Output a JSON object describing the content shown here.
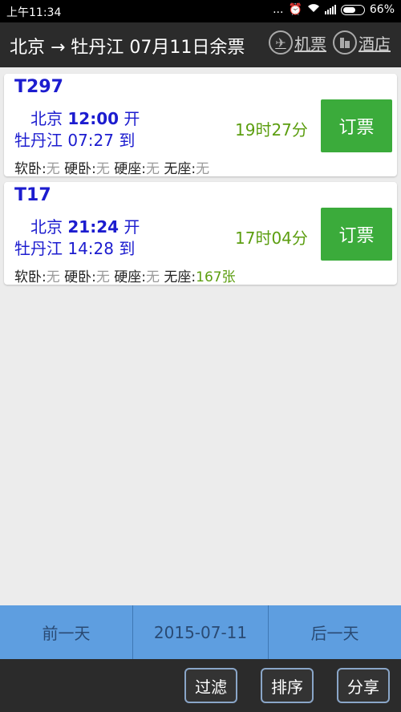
{
  "status": {
    "time": "上午11:34",
    "dots": "...",
    "battery": "66%",
    "battery_level": 0.66
  },
  "header": {
    "title": "北京 → 牡丹江 07月11日余票",
    "flights_label": "机票",
    "hotels_label": "酒店",
    "flights_icon": "airplane-icon",
    "hotels_icon": "hotel-icon"
  },
  "trains": [
    {
      "no": "T297",
      "from": "北京",
      "dep_time": "12:00",
      "dep_suffix": "开",
      "to": "牡丹江",
      "arr_time": "07:27",
      "arr_suffix": "到",
      "duration": "19时27分",
      "book_label": "订票",
      "seats": [
        {
          "type": "软卧",
          "value": "无"
        },
        {
          "type": "硬卧",
          "value": "无"
        },
        {
          "type": "硬座",
          "value": "无"
        },
        {
          "type": "无座",
          "value": "无"
        }
      ]
    },
    {
      "no": "T17",
      "from": "北京",
      "dep_time": "21:24",
      "dep_suffix": "开",
      "to": "牡丹江",
      "arr_time": "14:28",
      "arr_suffix": "到",
      "duration": "17时04分",
      "book_label": "订票",
      "seats": [
        {
          "type": "软卧",
          "value": "无"
        },
        {
          "type": "硬卧",
          "value": "无"
        },
        {
          "type": "硬座",
          "value": "无"
        },
        {
          "type": "无座",
          "value": "167张"
        }
      ]
    }
  ],
  "datebar": {
    "prev": "前一天",
    "date": "2015-07-11",
    "next": "后一天"
  },
  "footer": {
    "filter": "过滤",
    "sort": "排序",
    "share": "分享"
  },
  "colors": {
    "train_blue": "#1c1ccf",
    "green": "#3bab3b",
    "duration_green": "#5c9e10",
    "datebar_blue": "#5e9ee0"
  }
}
